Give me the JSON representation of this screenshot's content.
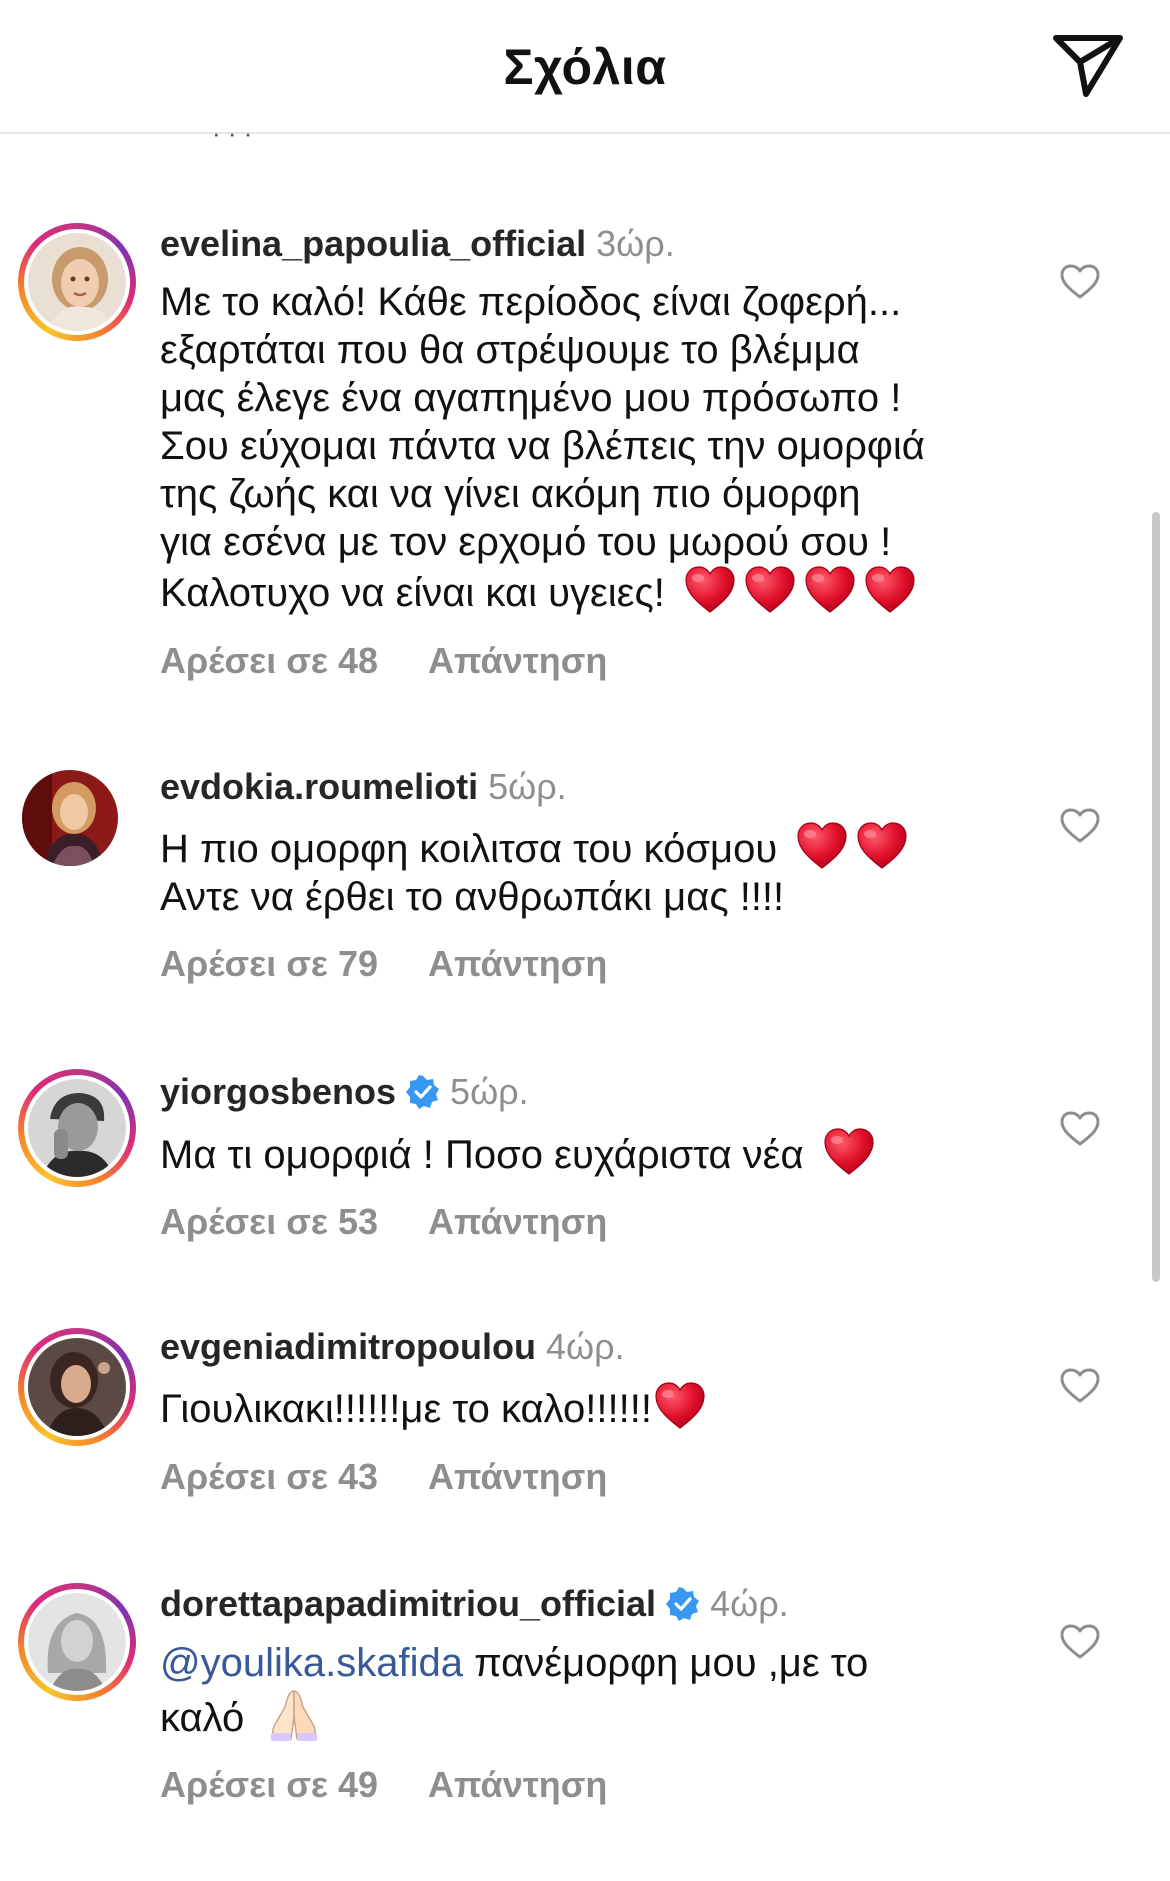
{
  "header": {
    "title": "Σχόλια"
  },
  "peek_text": "· · ·",
  "comments": [
    {
      "username": "evelina_papoulia_official",
      "time": "3ώρ.",
      "verified": false,
      "lines": [
        "Με το καλό! Κάθε περίοδος είναι ζοφερή...",
        "εξαρτάται που θα στρέψουμε  το βλέμμα",
        "μας έλεγε ένα αγαπημένο μου πρόσωπο !",
        "Σου εύχομαι πάντα να βλέπεις την ομορφιά",
        "της ζωής και να  γίνει ακόμη πιο όμορφη",
        "για εσένα  με τον ερχομό  του μωρού σου !",
        "Καλοτυχο να είναι και υγειες!"
      ],
      "emoji": "heart x4",
      "likes": "Αρέσει σε 48",
      "reply": "Απάντηση"
    },
    {
      "username": "evdokia.roumelioti",
      "time": "5ώρ.",
      "verified": false,
      "lines": [
        "Η πιο ομορφη κοιλιτσα του κόσμου",
        "Αντε να έρθει το ανθρωπάκι μας !!!!"
      ],
      "emoji": "heart x2",
      "likes": "Αρέσει σε 79",
      "reply": "Απάντηση"
    },
    {
      "username": "yiorgosbenos",
      "time": "5ώρ.",
      "verified": true,
      "lines": [
        "Μα τι ομορφιά ! Ποσο ευχάριστα νέα"
      ],
      "emoji": "heart x1",
      "likes": "Αρέσει σε 53",
      "reply": "Απάντηση"
    },
    {
      "username": "evgeniadimitropoulou",
      "time": "4ώρ.",
      "verified": false,
      "lines": [
        "Γιουλικακι!!!!!!με το καλο!!!!!!"
      ],
      "emoji": "heart x1",
      "likes": "Αρέσει σε 43",
      "reply": "Απάντηση"
    },
    {
      "username": "dorettapapadimitriou_official",
      "time": "4ώρ.",
      "verified": true,
      "mention": "@youlika.skafida",
      "lines": [
        " πανέμορφη μου ,με το",
        "καλό"
      ],
      "emoji": "praying hands",
      "likes": "Αρέσει σε 49",
      "reply": "Απάντηση"
    }
  ],
  "colors": {
    "accent_ring": "#dd2a7b",
    "verified": "#3897f0",
    "heart": "#e0102a",
    "muted": "#8e8e8e"
  }
}
